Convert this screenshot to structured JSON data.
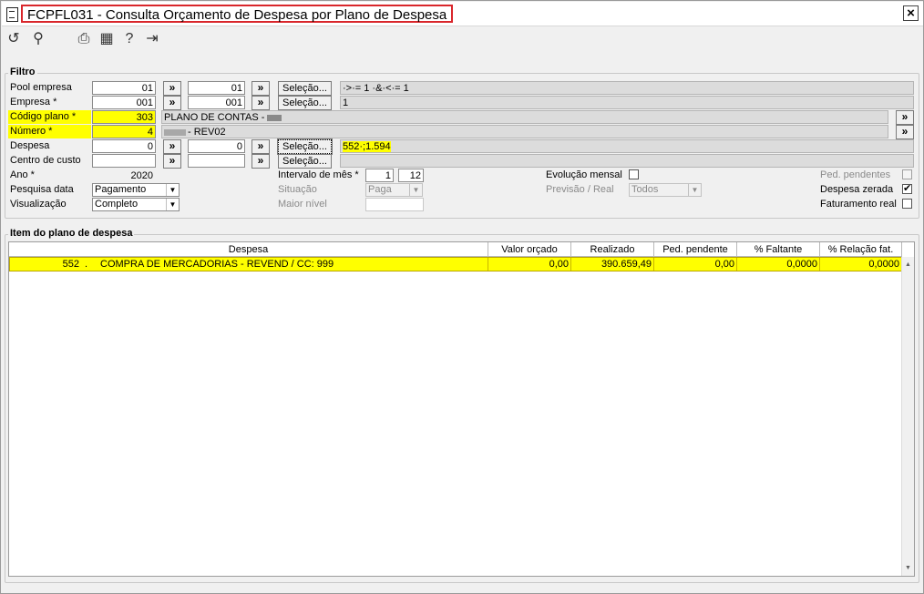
{
  "window": {
    "title": "FCPFL031 - Consulta Orçamento de Despesa por Plano de Despesa",
    "close_label": "×"
  },
  "toolbar": {
    "icons": [
      "↺",
      "⚲",
      "⎙",
      "▦",
      "?",
      "⇥"
    ]
  },
  "filtro": {
    "group_label": "Filtro",
    "arrow_label": "»",
    "selecao_label": "Seleção...",
    "pool_empresa": {
      "label": "Pool empresa",
      "from": "01",
      "to": "01",
      "summary": "·>·= 1 ·&·<·= 1"
    },
    "empresa": {
      "label": "Empresa *",
      "from": "001",
      "to": "001",
      "summary": "1"
    },
    "codigo_plano": {
      "label": "Código plano *",
      "value": "303",
      "description": "PLANO DE CONTAS - "
    },
    "numero": {
      "label": "Número *",
      "value": "4",
      "description": "- REV02"
    },
    "despesa": {
      "label": "Despesa",
      "from": "0",
      "to": "0",
      "summary": "552·;1.594"
    },
    "centro_custo": {
      "label": "Centro de custo",
      "from": "",
      "to": "",
      "summary": ""
    },
    "ano": {
      "label": "Ano *",
      "value": "2020"
    },
    "pesquisa_data": {
      "label": "Pesquisa data",
      "value": "Pagamento"
    },
    "visualizacao": {
      "label": "Visualização",
      "value": "Completo"
    },
    "intervalo_mes": {
      "label": "Intervalo de mês *",
      "from": "1",
      "to": "12"
    },
    "situacao": {
      "label": "Situação",
      "value": "Paga"
    },
    "maior_nivel": {
      "label": "Maior nível",
      "value": ""
    },
    "evolucao_mensal": {
      "label": "Evolução mensal",
      "checked": false
    },
    "previsao_real": {
      "label": "Previsão / Real",
      "value": "Todos"
    },
    "ped_pendentes": {
      "label": "Ped. pendentes",
      "checked": false
    },
    "despesa_zerada": {
      "label": "Despesa zerada",
      "checked": true,
      "check_mark": "✔"
    },
    "faturamento_real": {
      "label": "Faturamento real",
      "checked": false
    }
  },
  "item_plano": {
    "group_label": "Item do plano de despesa",
    "columns": [
      "Despesa",
      "Valor orçado",
      "Realizado",
      "Ped. pendente",
      "% Faltante",
      "% Relação fat."
    ],
    "rows": [
      {
        "codigo": "552",
        "separador": ".",
        "descricao": "COMPRA DE MERCADORIAS - REVEND / CC: 999",
        "valor_orcado": "0,00",
        "realizado": "390.659,49",
        "ped_pendente": "0,00",
        "faltante": "0,0000",
        "relacao_fat": "0,0000"
      }
    ]
  }
}
